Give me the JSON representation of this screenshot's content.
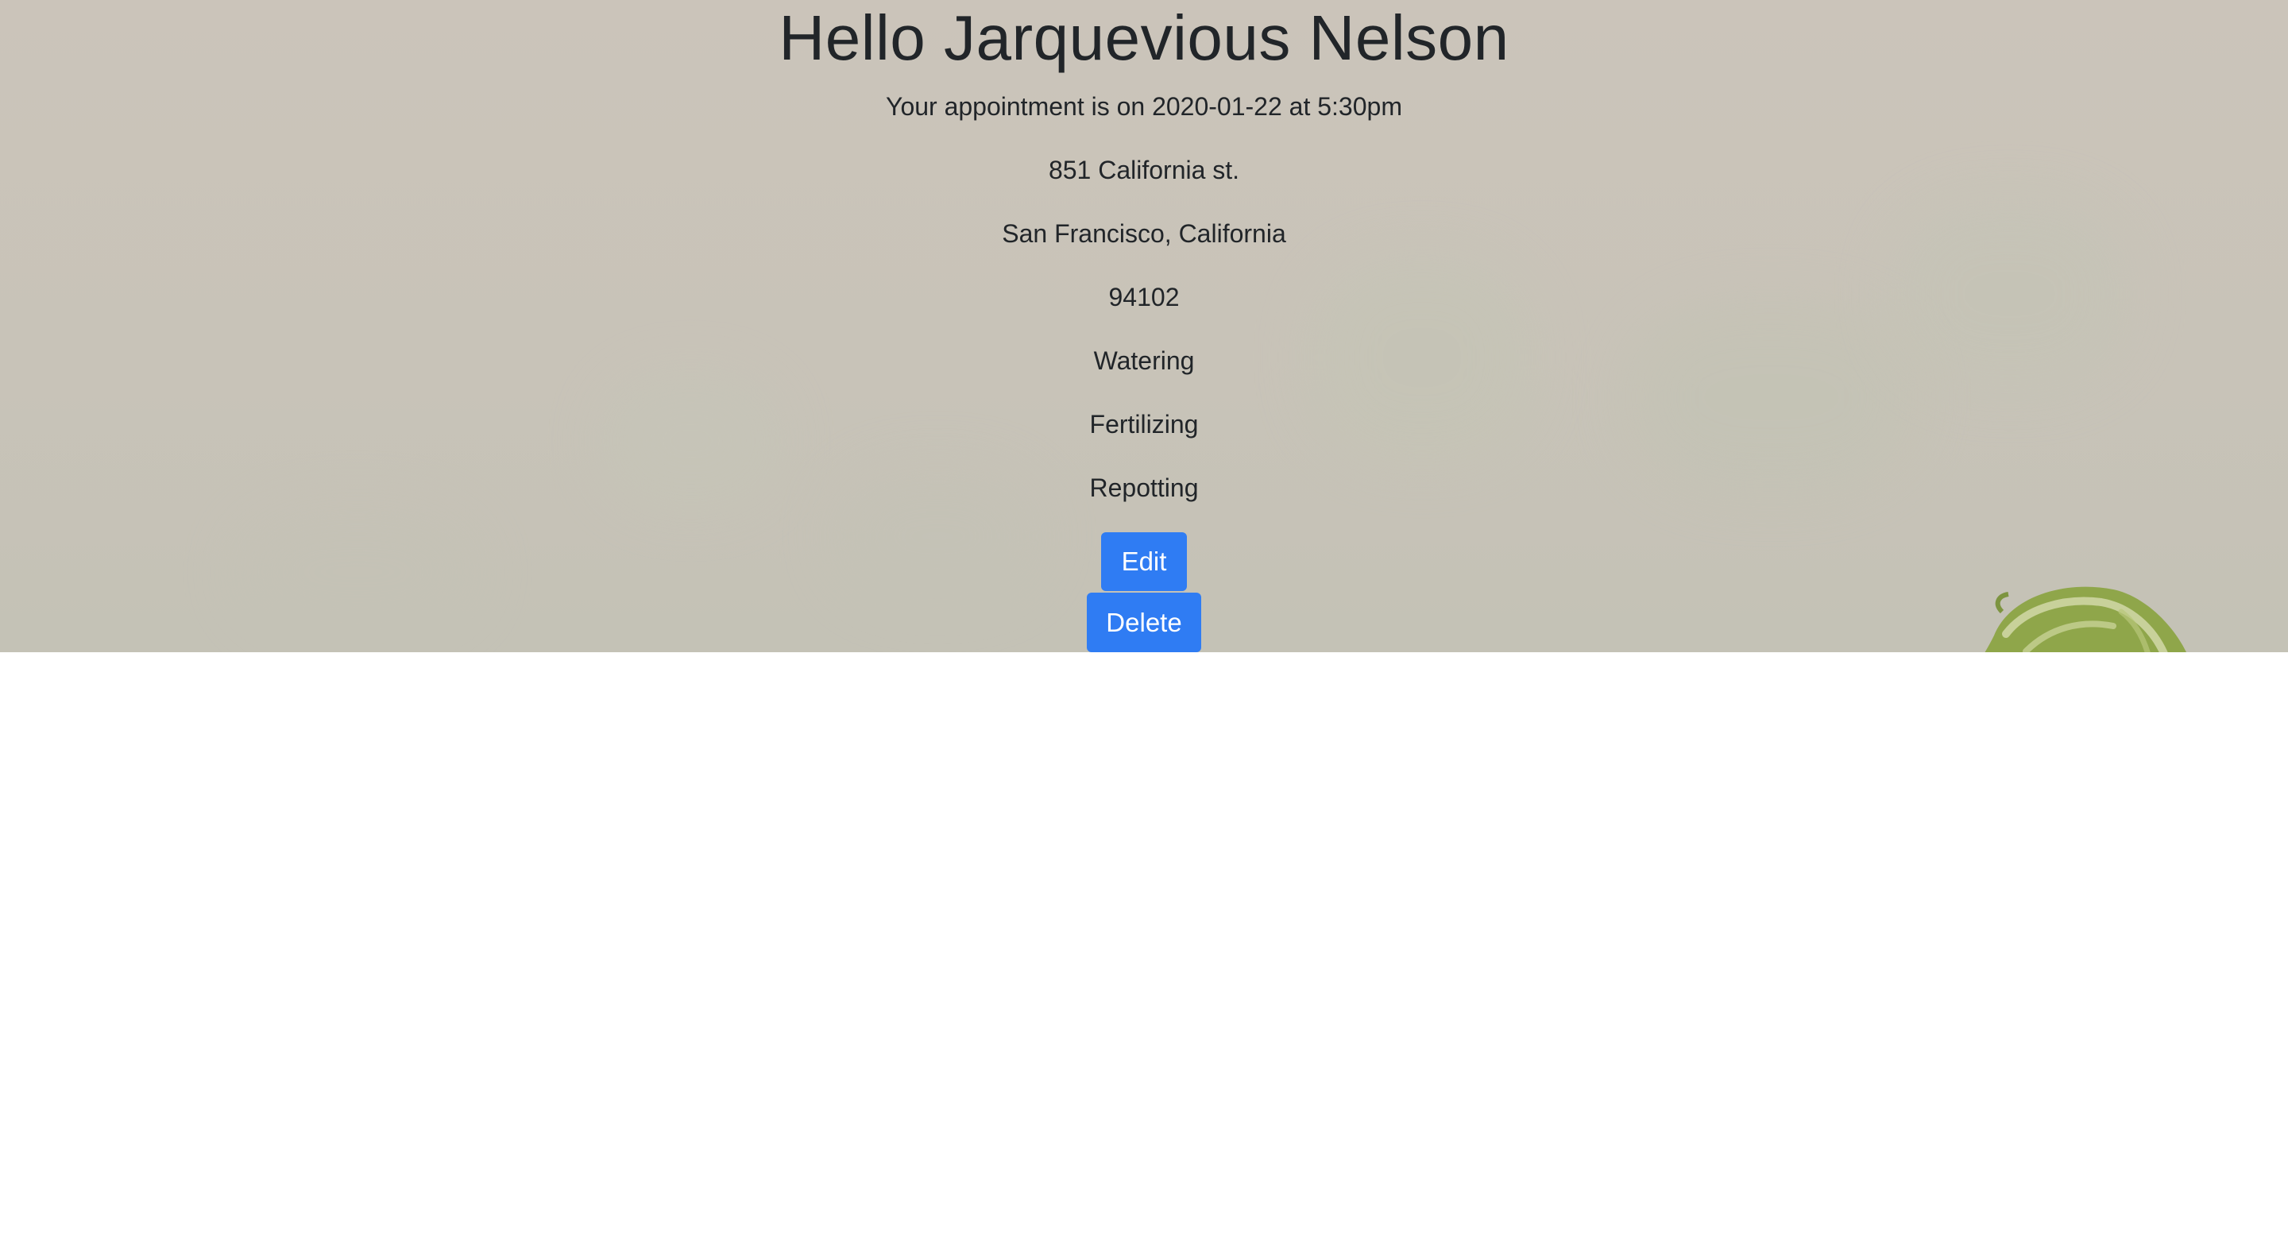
{
  "greeting": "Hello Jarquevious Nelson",
  "appointment": "Your appointment is on 2020-01-22 at 5:30pm",
  "address": {
    "street": "851 California st.",
    "city_state": "San Francisco, California",
    "zip": "94102"
  },
  "services": [
    "Watering",
    "Fertilizing",
    "Repotting"
  ],
  "actions": {
    "edit_label": "Edit",
    "delete_label": "Delete"
  },
  "colors": {
    "button": "#2f7cf3",
    "text": "#212529",
    "hero_background": "#cbc4ba"
  }
}
